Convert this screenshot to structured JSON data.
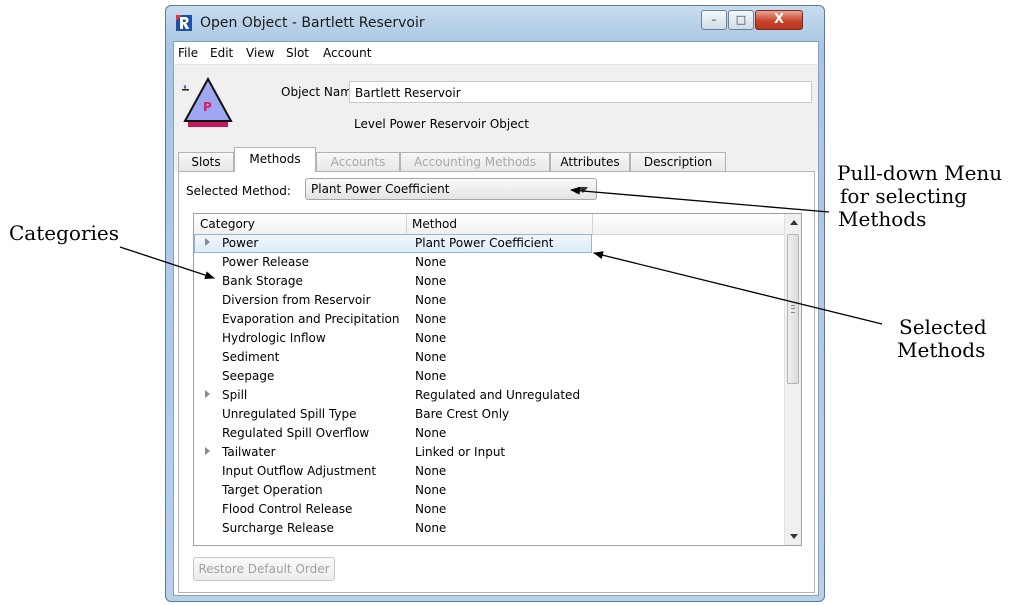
{
  "window": {
    "title": "Open Object - Bartlett Reservoir",
    "min_glyph": "–",
    "max_glyph": "□",
    "close_glyph": "X"
  },
  "menu": [
    "File",
    "Edit",
    "View",
    "Slot",
    "Account"
  ],
  "object": {
    "name_label": "Object Name:",
    "name_value": "Bartlett Reservoir",
    "type_label": "Level Power Reservoir Object",
    "icon": "level-power-reservoir-icon",
    "icon_letter": "P"
  },
  "tabs": [
    {
      "label": "Slots",
      "state": "normal"
    },
    {
      "label": "Methods",
      "state": "active"
    },
    {
      "label": "Accounts",
      "state": "disabled"
    },
    {
      "label": "Accounting Methods",
      "state": "disabled"
    },
    {
      "label": "Attributes",
      "state": "normal"
    },
    {
      "label": "Description",
      "state": "normal"
    }
  ],
  "methods_panel": {
    "selected_method_label": "Selected Method:",
    "selected_method_value": "Plant Power Coefficient",
    "columns": [
      "Category",
      "Method"
    ],
    "rows": [
      {
        "category": "Power",
        "method": "Plant Power Coefficient",
        "expandable": true,
        "selected": true
      },
      {
        "category": "Power Release",
        "method": "None",
        "expandable": false
      },
      {
        "category": "Bank Storage",
        "method": "None",
        "expandable": false
      },
      {
        "category": "Diversion from Reservoir",
        "method": "None",
        "expandable": false
      },
      {
        "category": "Evaporation and Precipitation",
        "method": "None",
        "expandable": false
      },
      {
        "category": "Hydrologic Inflow",
        "method": "None",
        "expandable": false
      },
      {
        "category": "Sediment",
        "method": "None",
        "expandable": false
      },
      {
        "category": "Seepage",
        "method": "None",
        "expandable": false
      },
      {
        "category": "Spill",
        "method": "Regulated and Unregulated",
        "expandable": true
      },
      {
        "category": "Unregulated Spill Type",
        "method": "Bare Crest Only",
        "expandable": false
      },
      {
        "category": "Regulated Spill Overflow",
        "method": "None",
        "expandable": false
      },
      {
        "category": "Tailwater",
        "method": "Linked or Input",
        "expandable": true
      },
      {
        "category": "Input Outflow Adjustment",
        "method": "None",
        "expandable": false
      },
      {
        "category": "Target Operation",
        "method": "None",
        "expandable": false
      },
      {
        "category": "Flood Control Release",
        "method": "None",
        "expandable": false
      },
      {
        "category": "Surcharge Release",
        "method": "None",
        "expandable": false
      }
    ],
    "restore_button": "Restore Default Order"
  },
  "callouts": {
    "pulldown": [
      "Pull-down Menu",
      "for selecting",
      "Methods"
    ],
    "categories": "Categories",
    "selected": [
      "Selected",
      "Methods"
    ]
  },
  "colors": {
    "icon_fill": "#9ea7f0",
    "icon_base": "#c2185b",
    "icon_letter": "#d81b60",
    "selection_border": "#8fb6e0"
  }
}
